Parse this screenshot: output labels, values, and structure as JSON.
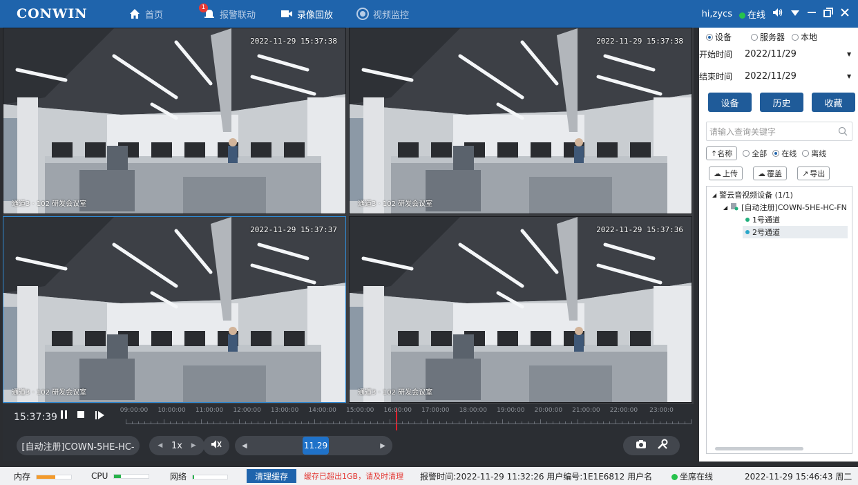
{
  "app": {
    "logo": "CONWIN",
    "nav": [
      {
        "label": "首页",
        "icon": "home-icon"
      },
      {
        "label": "报警联动",
        "icon": "alarm-bell-icon",
        "badge": "1"
      },
      {
        "label": "录像回放",
        "icon": "video-camera-icon",
        "active": true
      },
      {
        "label": "视频监控",
        "icon": "monitor-record-icon"
      }
    ],
    "user": "hi,zycs",
    "online_status": "在线"
  },
  "videos": [
    {
      "timestamp": "2022-11-29 15:37:38",
      "camera_label": "通道3 · 102 研发会议室"
    },
    {
      "timestamp": "2022-11-29 15:37:38",
      "camera_label": "通道3 · 102 研发会议室"
    },
    {
      "timestamp": "2022-11-29 15:37:37",
      "camera_label": "通道3 · 102 研发会议室"
    },
    {
      "timestamp": "2022-11-29 15:37:36",
      "camera_label": "通道3 · 102 研发会议室"
    }
  ],
  "timeline": {
    "current_time": "15:37:39",
    "hours": [
      "09:00:00",
      "10:00:00",
      "11:00:00",
      "12:00:00",
      "13:00:00",
      "14:00:00",
      "15:00:00",
      "16:00:00",
      "17:00:00",
      "18:00:00",
      "19:00:00",
      "20:00:00",
      "21:00:00",
      "22:00:00",
      "23:00:0"
    ]
  },
  "controls": {
    "device_label": "[自动注册]COWN-5HE-HC-",
    "speed": "1x",
    "date_label": "11.29"
  },
  "panel": {
    "source_options": [
      {
        "label": "设备",
        "checked": true
      },
      {
        "label": "服务器",
        "checked": false
      },
      {
        "label": "本地",
        "checked": false
      }
    ],
    "start_label": "开始时间",
    "start_value": "2022/11/29",
    "end_label": "结束时间",
    "end_value": "2022/11/29",
    "tabs": [
      "设备",
      "历史",
      "收藏"
    ],
    "search_placeholder": "请输入查询关键字",
    "sort_label": "↑名称",
    "filters": [
      {
        "label": "全部",
        "checked": false
      },
      {
        "label": "在线",
        "checked": true
      },
      {
        "label": "离线",
        "checked": false
      }
    ],
    "actions": [
      "上传",
      "覆盖",
      "导出"
    ],
    "tree": {
      "root": "警云音视频设备 (1/1)",
      "device": "[自动注册]COWN-5HE-HC-FN",
      "channels": [
        "1号通道",
        "2号通道"
      ]
    }
  },
  "status": {
    "memory_label": "内存",
    "cpu_label": "CPU",
    "network_label": "网络",
    "memory_level": 0.55,
    "cpu_level": 0.2,
    "network_level": 0.05,
    "clear_cache": "清理缓存",
    "warning": "缓存已超出1GB，请及时清理",
    "alarm_info": "报警时间:2022-11-29 11:32:26  用户编号:1E1E6812  用户名",
    "seat_status": "坐席在线",
    "datetime": "2022-11-29 15:46:43 周二"
  },
  "colors": {
    "topbar": "#1f64ac",
    "accent": "#1f72c9",
    "online": "#27c24c",
    "memory": "#f39a2b",
    "cpu": "#27b24a",
    "warning": "#e3342f"
  }
}
